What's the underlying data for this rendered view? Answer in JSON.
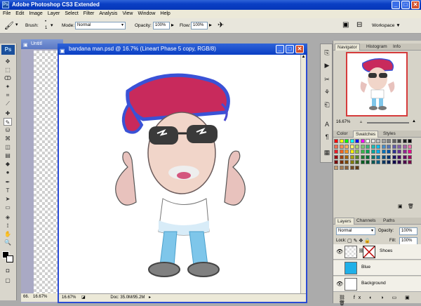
{
  "window": {
    "title": "Adobe Photoshop CS3 Extended",
    "logo": "Ps"
  },
  "menu": [
    "File",
    "Edit",
    "Image",
    "Layer",
    "Select",
    "Filter",
    "Analysis",
    "View",
    "Window",
    "Help"
  ],
  "options": {
    "brush_label": "Brush:",
    "brush_size": "1",
    "mode_label": "Mode:",
    "mode_value": "Normal",
    "opacity_label": "Opacity:",
    "opacity_value": "100%",
    "flow_label": "Flow:",
    "flow_value": "100%",
    "workspace_label": "Workspace ▼"
  },
  "documents": {
    "doc1_title": "Untitl",
    "doc1_zoom": "66.",
    "doc2_title": "bandana man.psd @ 16.7% (Lineart Phase 5 copy, RGB/8)",
    "doc2_zoom": "16.67%",
    "doc2_status": "Doc: 35.0M/95.2M",
    "left_zoom": "16.67%"
  },
  "navigator": {
    "tabs": [
      "Navigator",
      "Histogram",
      "Info"
    ],
    "zoom": "16.67%"
  },
  "color_panel": {
    "tabs": [
      "Color",
      "Swatches",
      "Styles"
    ],
    "swatch_colors": [
      "#ff0000",
      "#ffff00",
      "#00ff00",
      "#00ffff",
      "#0000ff",
      "#ff00ff",
      "#ffffff",
      "#e0e0e0",
      "#c0c0c0",
      "#a0a0a0",
      "#808080",
      "#606060",
      "#404040",
      "#202020",
      "#000000",
      "#f26c4f",
      "#f68e55",
      "#fbaf5c",
      "#fff467",
      "#acd372",
      "#7cc576",
      "#3bb878",
      "#1abbb4",
      "#00bff3",
      "#438ccb",
      "#5574b9",
      "#605ca8",
      "#855fa8",
      "#a763a8",
      "#f06ea9",
      "#ed1c24",
      "#f26522",
      "#f7941d",
      "#fff200",
      "#8dc63f",
      "#39b54a",
      "#00a651",
      "#00a99d",
      "#00aeef",
      "#0072bc",
      "#0054a6",
      "#2e3192",
      "#662d91",
      "#92278f",
      "#ec008c",
      "#9e0b0f",
      "#a0410d",
      "#a36209",
      "#aba000",
      "#598527",
      "#1a7b30",
      "#007236",
      "#00746b",
      "#0076a3",
      "#004b80",
      "#003471",
      "#1b1464",
      "#440e62",
      "#630460",
      "#9e005d",
      "#790000",
      "#7b2e00",
      "#7d4900",
      "#827b00",
      "#406618",
      "#005e20",
      "#005826",
      "#005952",
      "#005b7f",
      "#003663",
      "#002157",
      "#0d004c",
      "#32004b",
      "#4b0049",
      "#7b0046",
      "#c69c6d",
      "#a67c52",
      "#8c6239",
      "#754c24",
      "#603913"
    ]
  },
  "layers": {
    "tabs": [
      "Layers",
      "Channels",
      "Paths"
    ],
    "blend_mode": "Normal",
    "opacity_label": "Opacity:",
    "opacity_value": "100%",
    "lock_label": "Lock:",
    "fill_label": "Fill:",
    "fill_value": "100%",
    "items": [
      {
        "name": "Shoes"
      },
      {
        "name": "Blue"
      },
      {
        "name": "Background"
      }
    ]
  }
}
